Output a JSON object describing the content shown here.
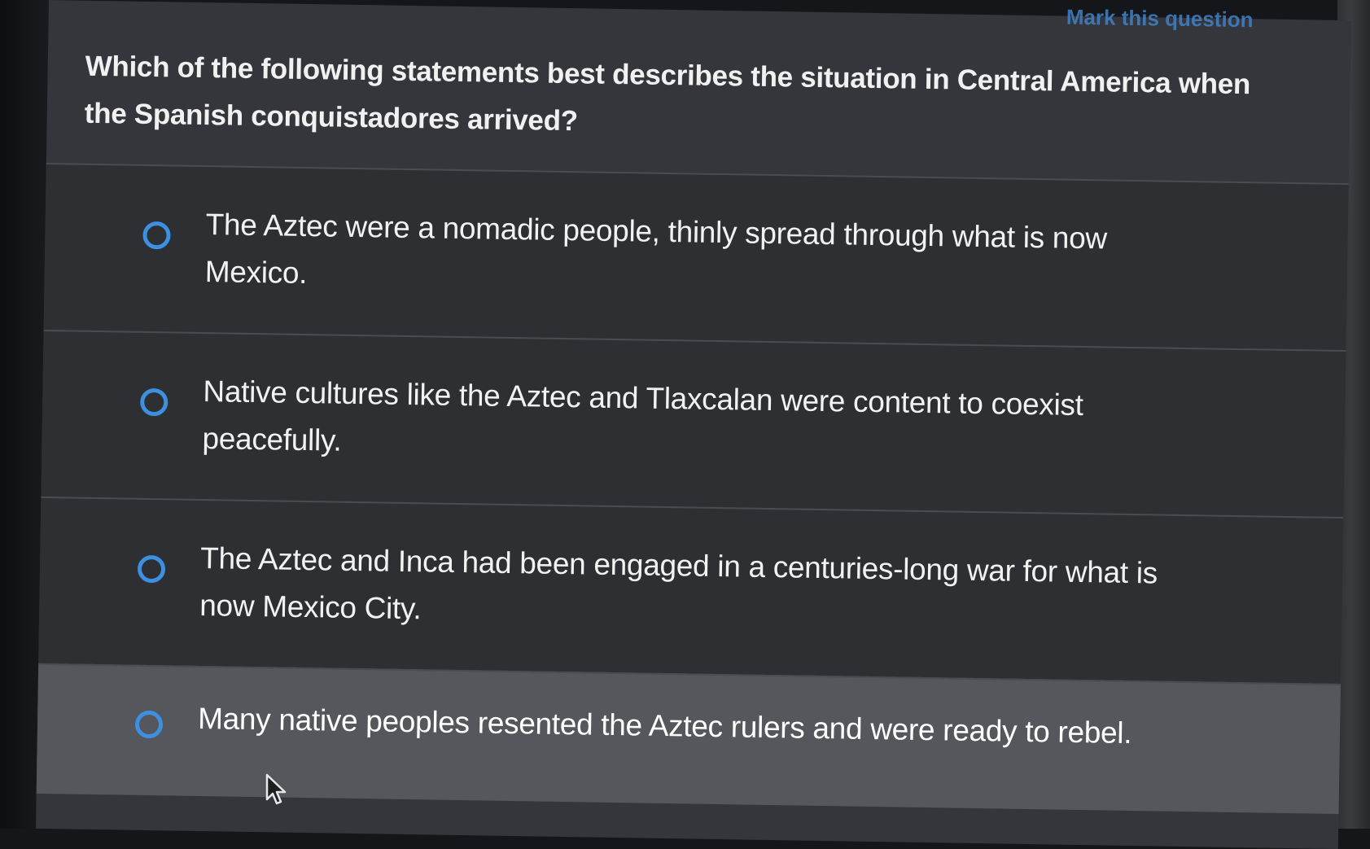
{
  "header": {
    "top_link": "Mark this question"
  },
  "question": {
    "text": "Which of the following statements best describes the situation in Central America when the Spanish conquistadores arrived?"
  },
  "options": [
    {
      "label": "The Aztec were a nomadic people, thinly spread through what is now Mexico.",
      "selected": false
    },
    {
      "label": "Native cultures like the Aztec and Tlaxcalan were content to coexist peacefully.",
      "selected": false
    },
    {
      "label": "The Aztec and Inca had been engaged in a centuries-long war for what is now Mexico City.",
      "selected": false
    },
    {
      "label": "Many native peoples resented the Aztec rulers and were ready to rebel.",
      "selected": false
    }
  ],
  "colors": {
    "accent": "#3d8fe0",
    "background": "#34363b",
    "hover_row": "#55575c"
  },
  "icons": {
    "radio": "radio-unchecked-icon",
    "pointer": "mouse-pointer-icon"
  }
}
